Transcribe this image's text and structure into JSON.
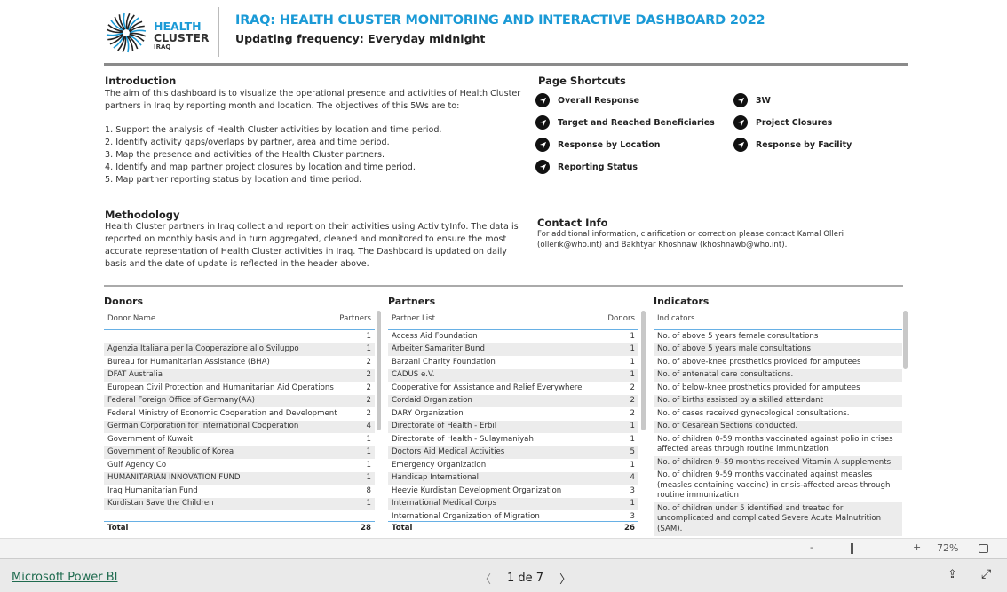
{
  "header": {
    "logo_lines": [
      "HEALTH",
      "CLUSTER",
      "IRAQ"
    ],
    "title": "IRAQ: HEALTH CLUSTER MONITORING AND INTERACTIVE DASHBOARD 2022",
    "subtitle": "Updating frequency: Everyday midnight",
    "accent": "#1b9ad6"
  },
  "introduction": {
    "heading": "Introduction",
    "paragraph": "The aim of this dashboard is to visualize the operational presence and activities of Health Cluster partners in Iraq by reporting month and location. The objectives of this 5Ws are to:",
    "items": [
      "1. Support the analysis of Health Cluster activities by location and time period.",
      "2. Identify activity gaps/overlaps by partner, area and time period.",
      "3. Map the presence and activities of the Health Cluster partners.",
      "4. Identify and map partner project closures by location and time period.",
      "5. Map partner reporting status by location and time period."
    ]
  },
  "methodology": {
    "heading": "Methodology",
    "text": "Health Cluster partners in Iraq collect and report on their activities using ActivityInfo. The data is reported on monthly basis and in turn aggregated, cleaned and monitored to ensure the most accurate representation of Health Cluster activities in Iraq. The Dashboard is updated on daily basis and the date of update is reflected in the header above."
  },
  "shortcuts": {
    "heading": "Page Shortcuts",
    "icon": "navigate-arrow-icon",
    "items": [
      "Overall Response",
      "Target and Reached Beneficiaries",
      "Response by Location",
      "Reporting Status",
      "3W",
      "Project Closures",
      "Response by Facility"
    ]
  },
  "contact": {
    "heading": "Contact Info",
    "text": "For additional information, clarification or correction please contact Kamal Olleri (ollerik@who.int) and Bakhtyar Khoshnaw (khoshnawb@who.int)."
  },
  "donors": {
    "heading": "Donors",
    "col1": "Donor Name",
    "col2": "Partners",
    "rows": [
      [
        "",
        "1"
      ],
      [
        "Agenzia Italiana per la Cooperazione allo Sviluppo",
        "1"
      ],
      [
        "Bureau for Humanitarian Assistance (BHA)",
        "2"
      ],
      [
        "DFAT Australia",
        "2"
      ],
      [
        "European Civil Protection and Humanitarian Aid Operations",
        "2"
      ],
      [
        "Federal Foreign Office of Germany(AA)",
        "2"
      ],
      [
        "Federal Ministry of Economic Cooperation and Development",
        "2"
      ],
      [
        "German Corporation for International Cooperation",
        "4"
      ],
      [
        "Government of Kuwait",
        "1"
      ],
      [
        "Government of Republic of Korea",
        "1"
      ],
      [
        "Gulf Agency Co",
        "1"
      ],
      [
        "HUMANITARIAN INNOVATION FUND",
        "1"
      ],
      [
        "Iraq Humanitarian Fund",
        "8"
      ],
      [
        "Kurdistan Save the Children",
        "1"
      ]
    ],
    "total_label": "Total",
    "total": "28"
  },
  "partners": {
    "heading": "Partners",
    "col1": "Partner List",
    "col2": "Donors",
    "rows": [
      [
        "Access Aid Foundation",
        "1"
      ],
      [
        "Arbeiter Samariter Bund",
        "1"
      ],
      [
        "Barzani Charity Foundation",
        "1"
      ],
      [
        "CADUS e.V.",
        "1"
      ],
      [
        "Cooperative for Assistance and Relief Everywhere",
        "2"
      ],
      [
        "Cordaid Organization",
        "2"
      ],
      [
        "DARY Organization",
        "2"
      ],
      [
        "Directorate of Health - Erbil",
        "1"
      ],
      [
        "Directorate of Health - Sulaymaniyah",
        "1"
      ],
      [
        "Doctors Aid Medical Activities",
        "5"
      ],
      [
        "Emergency Organization",
        "1"
      ],
      [
        "Handicap International",
        "4"
      ],
      [
        "Heevie Kurdistan Development Organization",
        "3"
      ],
      [
        "International Medical Corps",
        "1"
      ],
      [
        "International Organization of Migration",
        "3"
      ]
    ],
    "total_label": "Total",
    "total": "26"
  },
  "indicators": {
    "heading": "Indicators",
    "col1": "Indicators",
    "rows": [
      "No. of above 5 years female consultations",
      "No. of above 5 years male consultations",
      "No. of above-knee prosthetics provided for amputees",
      "No. of antenatal care consultations.",
      "No. of below-knee prosthetics provided for amputees",
      "No. of births assisted by a skilled attendant",
      "No. of cases received gynecological consultations.",
      "No. of Cesarean Sections conducted.",
      "No. of children 0-59 months vaccinated against polio in crises affected areas through routine immunization",
      "No. of children 9–59 months received Vitamin A supplements",
      "No. of children 9-59 months vaccinated against measles (measles containing vaccine) in crisis-affected areas through routine immunization",
      "No. of children under 5 identified and treated for uncomplicated and complicated Severe Acute Malnutrition (SAM)."
    ]
  },
  "zoom": {
    "minus": "-",
    "plus": "+",
    "level": "72%",
    "level_fraction": 0.36
  },
  "footer": {
    "brand": "Microsoft Power BI",
    "page": "1 de 7",
    "prev": "〈",
    "next": "〉"
  }
}
